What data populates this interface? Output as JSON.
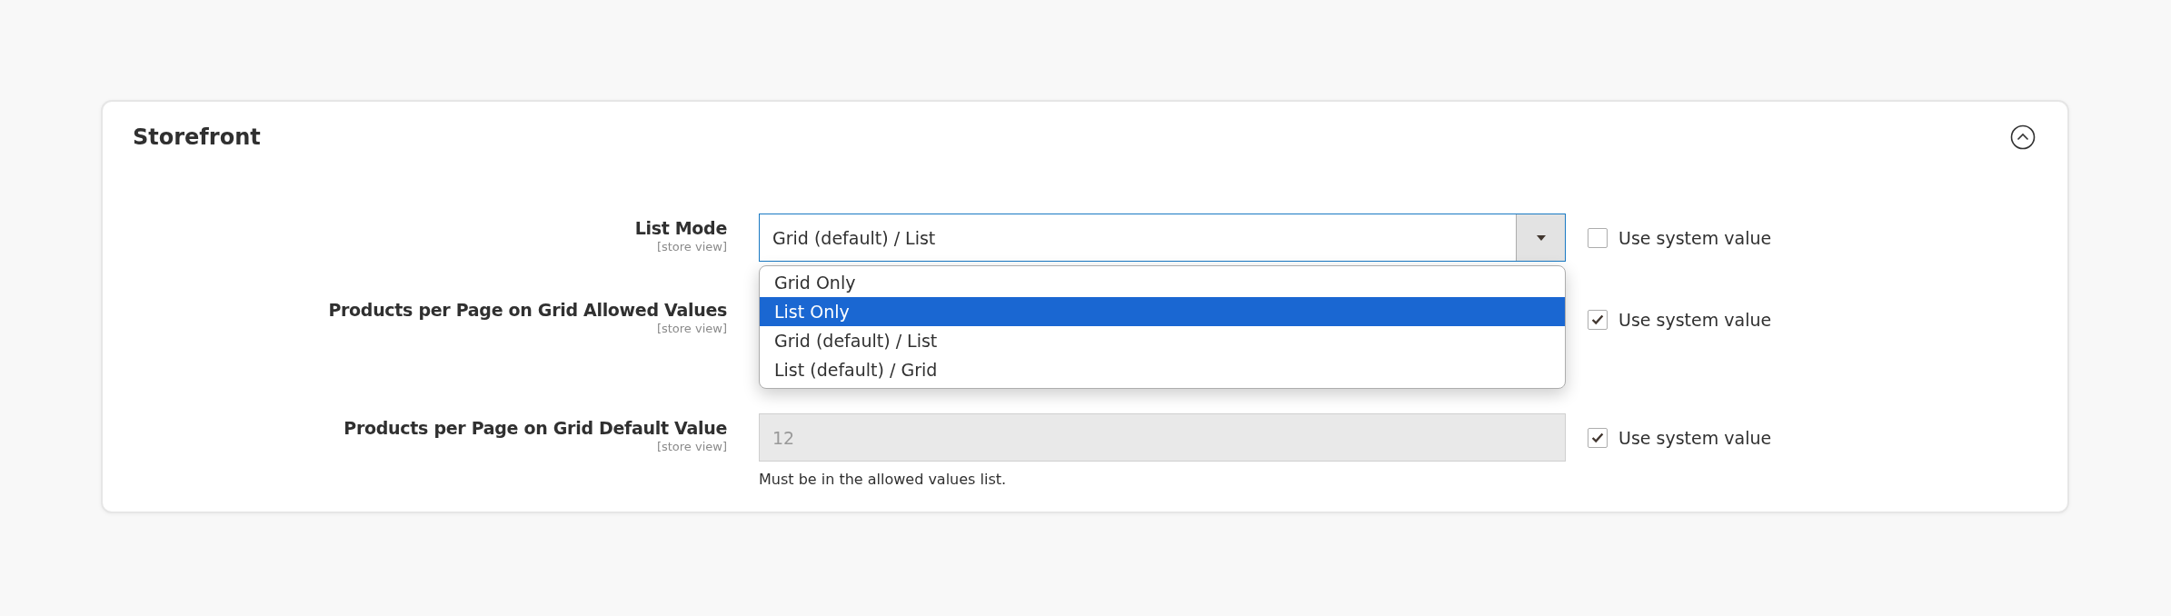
{
  "section": {
    "title": "Storefront",
    "expanded": true
  },
  "fields": [
    {
      "label": "List Mode",
      "scope": "[store view]",
      "kind": "select",
      "value": "Grid (default) / List",
      "open": true,
      "use_system_value": {
        "label": "Use system value",
        "checked": false
      },
      "options": [
        {
          "label": "Grid Only",
          "highlighted": false
        },
        {
          "label": "List Only",
          "highlighted": true
        },
        {
          "label": "Grid (default) / List",
          "highlighted": false
        },
        {
          "label": "List (default) / Grid",
          "highlighted": false
        }
      ]
    },
    {
      "label": "Products per Page on Grid Allowed Values",
      "scope": "[store view]",
      "use_system_value": {
        "label": "Use system value",
        "checked": true
      }
    },
    {
      "label": "Products per Page on Grid Default Value",
      "scope": "[store view]",
      "kind": "text",
      "value": "12",
      "disabled": true,
      "note": "Must be in the allowed values list.",
      "use_system_value": {
        "label": "Use system value",
        "checked": true
      }
    }
  ]
}
